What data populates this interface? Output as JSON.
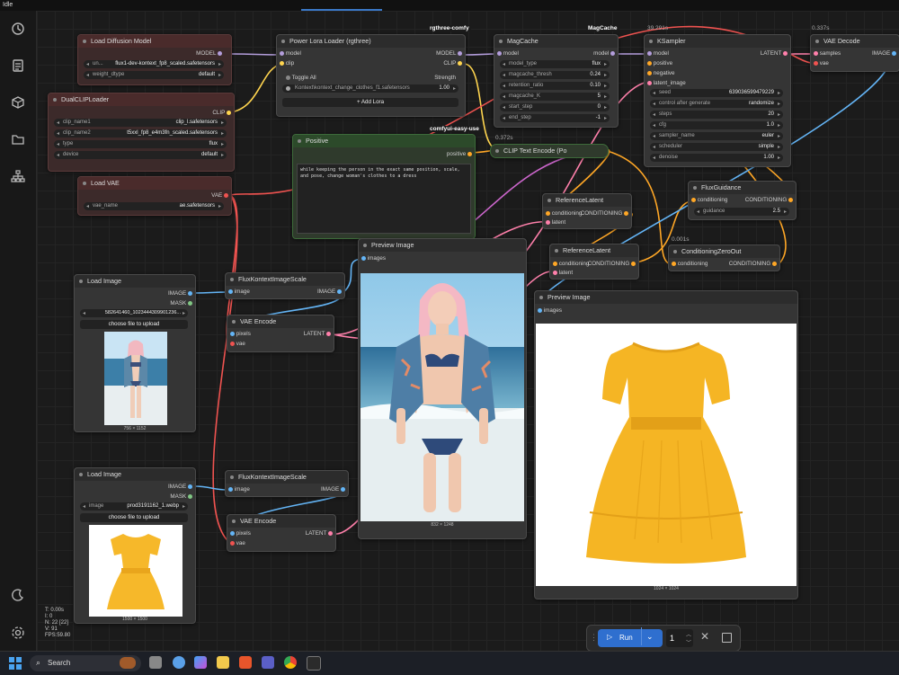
{
  "app": {
    "status": "Idle"
  },
  "stats": {
    "t": "T: 0.00s",
    "i": "I: 0",
    "n": "N: 22 [22]",
    "v": "V: 91",
    "fps": "FPS:59.80"
  },
  "sidebar": {
    "icons": [
      "history-icon",
      "queue-icon",
      "node-library-icon",
      "model-library-icon",
      "workflows-icon"
    ],
    "bottom_icons": [
      "theme-toggle-icon",
      "settings-icon"
    ]
  },
  "nodes": {
    "load_diffusion": {
      "title": "Load Diffusion Model",
      "out_model": "MODEL",
      "unet_label": "un...",
      "unet_value": "flux1-dev-kontext_fp8_scaled.safetensors",
      "dtype_label": "weight_dtype",
      "dtype_value": "default"
    },
    "dualclip": {
      "title": "DualCLIPLoader",
      "out_clip": "CLIP",
      "w1_label": "clip_name1",
      "w1_value": "clip_l.safetensors",
      "w2_label": "clip_name2",
      "w2_value": "t5xxl_fp8_e4m3fn_scaled.safetensors",
      "w3_label": "type",
      "w3_value": "flux",
      "w4_label": "device",
      "w4_value": "default"
    },
    "load_vae": {
      "title": "Load VAE",
      "out_vae": "VAE",
      "vae_label": "vae_name",
      "vae_value": "ae.safetensors"
    },
    "power_lora": {
      "title": "Power Lora Loader (rgthree)",
      "tag": "rgthree-comfy",
      "in_model": "model",
      "in_clip": "clip",
      "out_model": "MODEL",
      "out_clip": "CLIP",
      "toggle_all": "Toggle All",
      "strength": "Strength",
      "lora_name": "Kontext\\kontext_change_clothes_f1.safetensors",
      "lora_strength": "1.00",
      "add_lora": "+ Add Lora"
    },
    "magcache": {
      "title": "MagCache",
      "tag": "MagCache",
      "in_model": "model",
      "out_model": "model",
      "widgets": [
        {
          "label": "model_type",
          "value": "flux"
        },
        {
          "label": "magcache_thresh",
          "value": "0.24"
        },
        {
          "label": "retention_ratio",
          "value": "0.10"
        },
        {
          "label": "magcache_K",
          "value": "5"
        },
        {
          "label": "start_step",
          "value": "0"
        },
        {
          "label": "end_step",
          "value": "-1"
        }
      ]
    },
    "ksampler": {
      "title": "KSampler",
      "time": "39.291s",
      "in_model": "model",
      "in_positive": "positive",
      "in_negative": "negative",
      "in_latent": "latent_image",
      "out_latent": "LATENT",
      "widgets": [
        {
          "label": "seed",
          "value": "639036599479229"
        },
        {
          "label": "control after generate",
          "value": "randomize"
        },
        {
          "label": "steps",
          "value": "20"
        },
        {
          "label": "cfg",
          "value": "1.0"
        },
        {
          "label": "sampler_name",
          "value": "euler"
        },
        {
          "label": "scheduler",
          "value": "simple"
        },
        {
          "label": "denoise",
          "value": "1.00"
        }
      ]
    },
    "vae_decode_top": {
      "title": "VAE Decode",
      "time": "0.337s",
      "in_samples": "samples",
      "in_vae": "vae",
      "out_image": "IMAGE"
    },
    "positive": {
      "title": "Positive",
      "tag": "comfyui-easy-use",
      "out": "positive",
      "text": "while keeping the person in the exact same position, scale, and pose, change woman's clothes to a dress"
    },
    "clip_encode": {
      "title": "CLIP Text Encode (Po",
      "time": "0.372s"
    },
    "flux_guidance": {
      "title": "FluxGuidance",
      "in_cond": "conditioning",
      "out_cond": "CONDITIONING",
      "guidance_label": "guidance",
      "guidance_value": "2.5"
    },
    "ref_latent1": {
      "title": "ReferenceLatent",
      "in_cond": "conditioning",
      "out_cond": "CONDITIONING",
      "in_latent": "latent"
    },
    "ref_latent2": {
      "title": "ReferenceLatent",
      "in_cond": "conditioning",
      "out_cond": "CONDITIONING",
      "in_latent": "latent"
    },
    "cond_zero": {
      "title": "ConditioningZeroOut",
      "time": "0.001s",
      "in_cond": "conditioning",
      "out_cond": "CONDITIONING"
    },
    "load_image1": {
      "title": "Load Image",
      "out_image": "IMAGE",
      "out_mask": "MASK",
      "image_value": "582641460_1023444309901236...",
      "upload": "choose file to upload",
      "size": "756 × 1152"
    },
    "load_image2": {
      "title": "Load Image",
      "out_image": "IMAGE",
      "out_mask": "MASK",
      "image_label": "image",
      "image_value": "prod3191162_1.webp",
      "upload": "choose file to upload",
      "size": "1500 × 1500"
    },
    "scale1": {
      "title": "FluxKontextImageScale",
      "in_image": "image",
      "out_image": "IMAGE"
    },
    "scale2": {
      "title": "FluxKontextImageScale",
      "in_image": "image",
      "out_image": "IMAGE"
    },
    "vae_enc1": {
      "title": "VAE Encode",
      "in_pixels": "pixels",
      "in_vae": "vae",
      "out_latent": "LATENT"
    },
    "vae_enc2": {
      "title": "VAE Encode",
      "in_pixels": "pixels",
      "in_vae": "vae",
      "out_latent": "LATENT"
    },
    "preview1": {
      "title": "Preview Image",
      "in_images": "images",
      "size": "832 × 1248"
    },
    "preview2": {
      "title": "Preview Image",
      "in_images": "images",
      "size": "1024 × 1024"
    }
  },
  "runbar": {
    "run_label": "Run",
    "count": "1"
  },
  "taskbar": {
    "search": "Search"
  },
  "colors": {
    "accent": "#2f6fcf",
    "model_wire": "#b39ddb",
    "clip_wire": "#ffd54f",
    "vae_wire": "#ef5350",
    "image_wire": "#64b5f6",
    "cond_wire": "#ffa726",
    "latent_wire": "#ff80ab"
  }
}
